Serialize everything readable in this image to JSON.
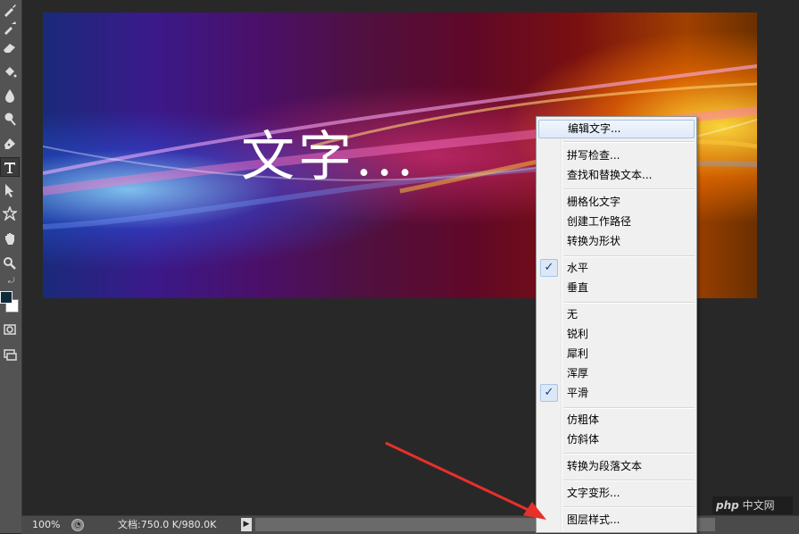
{
  "canvas": {
    "text": "文字..."
  },
  "statusbar": {
    "zoom": "100%",
    "doc_info": "文档:750.0 K/980.0K"
  },
  "menu": {
    "items": [
      {
        "label": "编辑文字...",
        "checked": false,
        "highlighted": true
      },
      {
        "label": "拼写检查...",
        "checked": false
      },
      {
        "label": "查找和替换文本...",
        "checked": false
      },
      {
        "label": "栅格化文字",
        "checked": false
      },
      {
        "label": "创建工作路径",
        "checked": false
      },
      {
        "label": "转换为形状",
        "checked": false
      },
      {
        "label": "水平",
        "checked": true
      },
      {
        "label": "垂直",
        "checked": false
      },
      {
        "label": "无",
        "checked": false
      },
      {
        "label": "锐利",
        "checked": false
      },
      {
        "label": "犀利",
        "checked": false
      },
      {
        "label": "浑厚",
        "checked": false
      },
      {
        "label": "平滑",
        "checked": true
      },
      {
        "label": "仿粗体",
        "checked": false
      },
      {
        "label": "仿斜体",
        "checked": false
      },
      {
        "label": "转换为段落文本",
        "checked": false
      },
      {
        "label": "文字变形...",
        "checked": false
      },
      {
        "label": "图层样式...",
        "checked": false
      }
    ],
    "check_glyph": "✓"
  },
  "watermark": {
    "brand": "php",
    "site": "中文网"
  },
  "colors": {
    "foreground": "#0d2a3a",
    "background": "#ffffff",
    "annotation_arrow": "#e8302a"
  },
  "icons": [
    "brush-icon",
    "eraser-icon",
    "paint-bucket-icon",
    "blur-icon",
    "dodge-icon",
    "pen-icon",
    "type-icon",
    "path-select-icon",
    "shape-icon",
    "hand-icon",
    "zoom-icon",
    "quick-mask-icon",
    "screen-mode-icon"
  ]
}
